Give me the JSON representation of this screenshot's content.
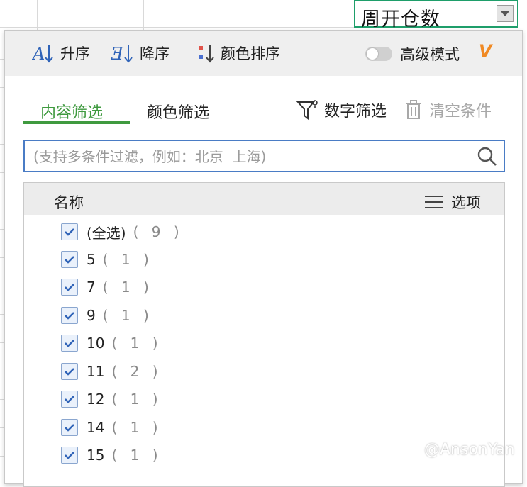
{
  "column_header": {
    "title": "周开仓数"
  },
  "sort_bar": {
    "ascending": "升序",
    "descending": "降序",
    "color_sort": "颜色排序",
    "advanced_mode": "高级模式",
    "vip_badge": "V"
  },
  "tabs": {
    "content_filter": "内容筛选",
    "color_filter": "颜色筛选",
    "number_filter": "数字筛选",
    "clear_conditions": "清空条件"
  },
  "search": {
    "placeholder": "(支持多条件过滤，例如：北京  上海)"
  },
  "list": {
    "header_name": "名称",
    "header_options": "选项",
    "items": [
      {
        "label": "(全选)",
        "count": "( 9 )",
        "checked": true
      },
      {
        "label": "5",
        "count": "( 1 )",
        "checked": true
      },
      {
        "label": "7",
        "count": "( 1 )",
        "checked": true
      },
      {
        "label": "9",
        "count": "( 1 )",
        "checked": true
      },
      {
        "label": "10",
        "count": "( 1 )",
        "checked": true
      },
      {
        "label": "11",
        "count": "( 2 )",
        "checked": true
      },
      {
        "label": "12",
        "count": "( 1 )",
        "checked": true
      },
      {
        "label": "14",
        "count": "( 1 )",
        "checked": true
      },
      {
        "label": "15",
        "count": "( 1 )",
        "checked": true
      }
    ]
  },
  "watermark": "@AnsonYan",
  "colors": {
    "accent_green": "#3f9a3f",
    "header_border": "#1e9e6a",
    "search_border": "#4a7cc5",
    "vip_orange": "#f08a24"
  }
}
